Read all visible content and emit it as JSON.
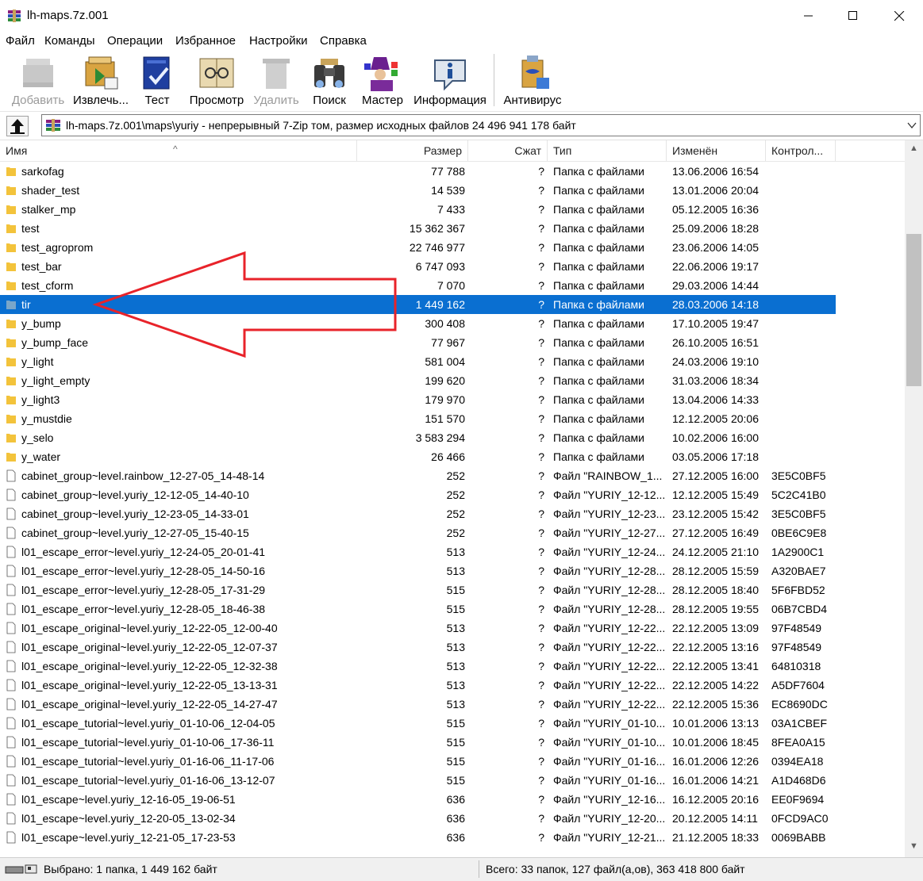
{
  "window": {
    "title": "lh-maps.7z.001"
  },
  "menu": [
    "Файл",
    "Команды",
    "Операции",
    "Избранное",
    "Настройки",
    "Справка"
  ],
  "toolbar": [
    {
      "label": "Добавить",
      "icon": "add-icon",
      "disabled": true
    },
    {
      "label": "Извлечь...",
      "icon": "extract-icon",
      "disabled": false
    },
    {
      "label": "Тест",
      "icon": "test-icon",
      "disabled": false
    },
    {
      "label": "Просмотр",
      "icon": "view-icon",
      "disabled": false
    },
    {
      "label": "Удалить",
      "icon": "delete-icon",
      "disabled": true
    },
    {
      "label": "Поиск",
      "icon": "find-icon",
      "disabled": false
    },
    {
      "label": "Мастер",
      "icon": "wizard-icon",
      "disabled": false
    },
    {
      "label": "Информация",
      "icon": "info-icon",
      "disabled": false
    },
    {
      "label": "Антивирус",
      "icon": "antivirus-icon",
      "disabled": false
    }
  ],
  "address": {
    "path": "lh-maps.7z.001\\maps\\yuriy - непрерывный 7-Zip том, размер исходных файлов 24 496 941 178 байт"
  },
  "columns": {
    "name": "Имя",
    "size": "Размер",
    "packed": "Сжат",
    "type": "Тип",
    "modified": "Изменён",
    "crc": "Контрол..."
  },
  "files": [
    {
      "name": "sarkofag",
      "size": "77 788",
      "packed": "?",
      "type": "Папка с файлами",
      "modified": "13.06.2006 16:54",
      "crc": "",
      "kind": "folder"
    },
    {
      "name": "shader_test",
      "size": "14 539",
      "packed": "?",
      "type": "Папка с файлами",
      "modified": "13.01.2006 20:04",
      "crc": "",
      "kind": "folder"
    },
    {
      "name": "stalker_mp",
      "size": "7 433",
      "packed": "?",
      "type": "Папка с файлами",
      "modified": "05.12.2005 16:36",
      "crc": "",
      "kind": "folder"
    },
    {
      "name": "test",
      "size": "15 362 367",
      "packed": "?",
      "type": "Папка с файлами",
      "modified": "25.09.2006 18:28",
      "crc": "",
      "kind": "folder"
    },
    {
      "name": "test_agroprom",
      "size": "22 746 977",
      "packed": "?",
      "type": "Папка с файлами",
      "modified": "23.06.2006 14:05",
      "crc": "",
      "kind": "folder"
    },
    {
      "name": "test_bar",
      "size": "6 747 093",
      "packed": "?",
      "type": "Папка с файлами",
      "modified": "22.06.2006 19:17",
      "crc": "",
      "kind": "folder"
    },
    {
      "name": "test_cform",
      "size": "7 070",
      "packed": "?",
      "type": "Папка с файлами",
      "modified": "29.03.2006 14:44",
      "crc": "",
      "kind": "folder"
    },
    {
      "name": "tir",
      "size": "1 449 162",
      "packed": "?",
      "type": "Папка с файлами",
      "modified": "28.03.2006 14:18",
      "crc": "",
      "kind": "folder",
      "selected": true
    },
    {
      "name": "y_bump",
      "size": "300 408",
      "packed": "?",
      "type": "Папка с файлами",
      "modified": "17.10.2005 19:47",
      "crc": "",
      "kind": "folder"
    },
    {
      "name": "y_bump_face",
      "size": "77 967",
      "packed": "?",
      "type": "Папка с файлами",
      "modified": "26.10.2005 16:51",
      "crc": "",
      "kind": "folder"
    },
    {
      "name": "y_light",
      "size": "581 004",
      "packed": "?",
      "type": "Папка с файлами",
      "modified": "24.03.2006 19:10",
      "crc": "",
      "kind": "folder"
    },
    {
      "name": "y_light_empty",
      "size": "199 620",
      "packed": "?",
      "type": "Папка с файлами",
      "modified": "31.03.2006 18:34",
      "crc": "",
      "kind": "folder"
    },
    {
      "name": "y_light3",
      "size": "179 970",
      "packed": "?",
      "type": "Папка с файлами",
      "modified": "13.04.2006 14:33",
      "crc": "",
      "kind": "folder"
    },
    {
      "name": "y_mustdie",
      "size": "151 570",
      "packed": "?",
      "type": "Папка с файлами",
      "modified": "12.12.2005 20:06",
      "crc": "",
      "kind": "folder"
    },
    {
      "name": "y_selo",
      "size": "3 583 294",
      "packed": "?",
      "type": "Папка с файлами",
      "modified": "10.02.2006 16:00",
      "crc": "",
      "kind": "folder"
    },
    {
      "name": "y_water",
      "size": "26 466",
      "packed": "?",
      "type": "Папка с файлами",
      "modified": "03.05.2006 17:18",
      "crc": "",
      "kind": "folder"
    },
    {
      "name": "cabinet_group~level.rainbow_12-27-05_14-48-14",
      "size": "252",
      "packed": "?",
      "type": "Файл \"RAINBOW_1...",
      "modified": "27.12.2005 16:00",
      "crc": "3E5C0BF5",
      "kind": "file"
    },
    {
      "name": "cabinet_group~level.yuriy_12-12-05_14-40-10",
      "size": "252",
      "packed": "?",
      "type": "Файл \"YURIY_12-12...",
      "modified": "12.12.2005 15:49",
      "crc": "5C2C41B0",
      "kind": "file"
    },
    {
      "name": "cabinet_group~level.yuriy_12-23-05_14-33-01",
      "size": "252",
      "packed": "?",
      "type": "Файл \"YURIY_12-23...",
      "modified": "23.12.2005 15:42",
      "crc": "3E5C0BF5",
      "kind": "file"
    },
    {
      "name": "cabinet_group~level.yuriy_12-27-05_15-40-15",
      "size": "252",
      "packed": "?",
      "type": "Файл \"YURIY_12-27...",
      "modified": "27.12.2005 16:49",
      "crc": "0BE6C9E8",
      "kind": "file"
    },
    {
      "name": "l01_escape_error~level.yuriy_12-24-05_20-01-41",
      "size": "513",
      "packed": "?",
      "type": "Файл \"YURIY_12-24...",
      "modified": "24.12.2005 21:10",
      "crc": "1A2900C1",
      "kind": "file"
    },
    {
      "name": "l01_escape_error~level.yuriy_12-28-05_14-50-16",
      "size": "513",
      "packed": "?",
      "type": "Файл \"YURIY_12-28...",
      "modified": "28.12.2005 15:59",
      "crc": "A320BAE7",
      "kind": "file"
    },
    {
      "name": "l01_escape_error~level.yuriy_12-28-05_17-31-29",
      "size": "515",
      "packed": "?",
      "type": "Файл \"YURIY_12-28...",
      "modified": "28.12.2005 18:40",
      "crc": "5F6FBD52",
      "kind": "file"
    },
    {
      "name": "l01_escape_error~level.yuriy_12-28-05_18-46-38",
      "size": "515",
      "packed": "?",
      "type": "Файл \"YURIY_12-28...",
      "modified": "28.12.2005 19:55",
      "crc": "06B7CBD4",
      "kind": "file"
    },
    {
      "name": "l01_escape_original~level.yuriy_12-22-05_12-00-40",
      "size": "513",
      "packed": "?",
      "type": "Файл \"YURIY_12-22...",
      "modified": "22.12.2005 13:09",
      "crc": "97F48549",
      "kind": "file"
    },
    {
      "name": "l01_escape_original~level.yuriy_12-22-05_12-07-37",
      "size": "513",
      "packed": "?",
      "type": "Файл \"YURIY_12-22...",
      "modified": "22.12.2005 13:16",
      "crc": "97F48549",
      "kind": "file"
    },
    {
      "name": "l01_escape_original~level.yuriy_12-22-05_12-32-38",
      "size": "513",
      "packed": "?",
      "type": "Файл \"YURIY_12-22...",
      "modified": "22.12.2005 13:41",
      "crc": "64810318",
      "kind": "file"
    },
    {
      "name": "l01_escape_original~level.yuriy_12-22-05_13-13-31",
      "size": "513",
      "packed": "?",
      "type": "Файл \"YURIY_12-22...",
      "modified": "22.12.2005 14:22",
      "crc": "A5DF7604",
      "kind": "file"
    },
    {
      "name": "l01_escape_original~level.yuriy_12-22-05_14-27-47",
      "size": "513",
      "packed": "?",
      "type": "Файл \"YURIY_12-22...",
      "modified": "22.12.2005 15:36",
      "crc": "EC8690DC",
      "kind": "file"
    },
    {
      "name": "l01_escape_tutorial~level.yuriy_01-10-06_12-04-05",
      "size": "515",
      "packed": "?",
      "type": "Файл \"YURIY_01-10...",
      "modified": "10.01.2006 13:13",
      "crc": "03A1CBEF",
      "kind": "file"
    },
    {
      "name": "l01_escape_tutorial~level.yuriy_01-10-06_17-36-11",
      "size": "515",
      "packed": "?",
      "type": "Файл \"YURIY_01-10...",
      "modified": "10.01.2006 18:45",
      "crc": "8FEA0A15",
      "kind": "file"
    },
    {
      "name": "l01_escape_tutorial~level.yuriy_01-16-06_11-17-06",
      "size": "515",
      "packed": "?",
      "type": "Файл \"YURIY_01-16...",
      "modified": "16.01.2006 12:26",
      "crc": "0394EA18",
      "kind": "file"
    },
    {
      "name": "l01_escape_tutorial~level.yuriy_01-16-06_13-12-07",
      "size": "515",
      "packed": "?",
      "type": "Файл \"YURIY_01-16...",
      "modified": "16.01.2006 14:21",
      "crc": "A1D468D6",
      "kind": "file"
    },
    {
      "name": "l01_escape~level.yuriy_12-16-05_19-06-51",
      "size": "636",
      "packed": "?",
      "type": "Файл \"YURIY_12-16...",
      "modified": "16.12.2005 20:16",
      "crc": "EE0F9694",
      "kind": "file"
    },
    {
      "name": "l01_escape~level.yuriy_12-20-05_13-02-34",
      "size": "636",
      "packed": "?",
      "type": "Файл \"YURIY_12-20...",
      "modified": "20.12.2005 14:11",
      "crc": "0FCD9AC0",
      "kind": "file"
    },
    {
      "name": "l01_escape~level.yuriy_12-21-05_17-23-53",
      "size": "636",
      "packed": "?",
      "type": "Файл \"YURIY_12-21...",
      "modified": "21.12.2005 18:33",
      "crc": "0069BABB",
      "kind": "file"
    }
  ],
  "status": {
    "selected": "Выбрано: 1 папка, 1 449 162 байт",
    "total": "Всего: 33 папок, 127 файл(а,ов), 363 418 800 байт"
  },
  "colors": {
    "selection": "#0a6fd1",
    "folder": "#f3c33b",
    "annotation_arrow": "#e8232a"
  }
}
